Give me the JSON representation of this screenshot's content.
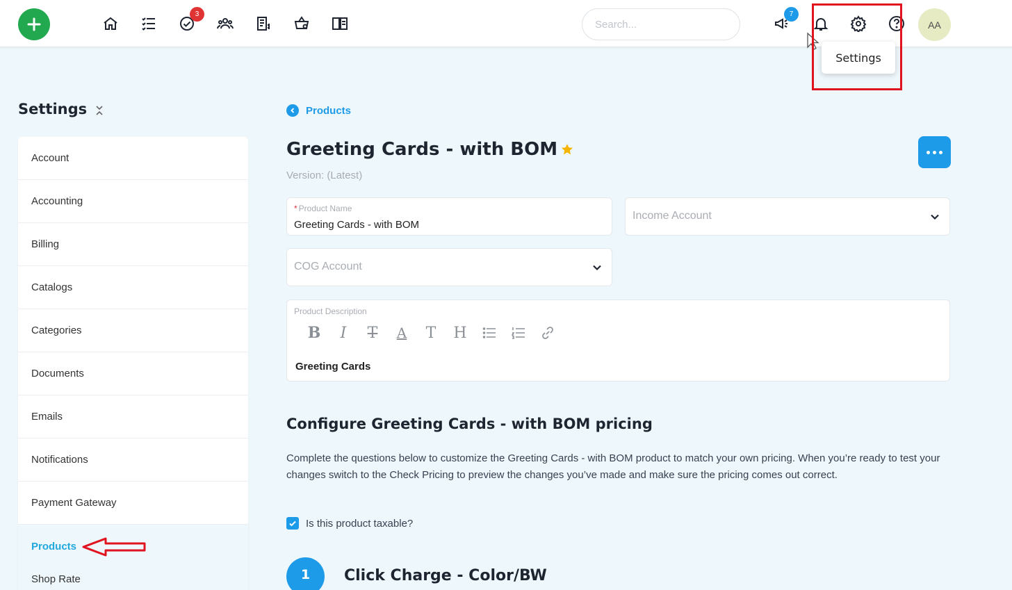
{
  "header": {
    "add_icon": "plus-icon",
    "nav_icons": [
      "home-icon",
      "list-icon",
      "tasks-check-icon",
      "users-group-icon",
      "invoice-icon",
      "shop-basket-icon",
      "catalog-book-icon"
    ],
    "tasks_badge": "3",
    "announcements_badge": "7",
    "search_placeholder": "Search...",
    "avatar_initials": "AA",
    "settings_tooltip": "Settings",
    "accent": "#1e9be8",
    "add_color": "#22a94f"
  },
  "sidebar": {
    "title": "Settings",
    "items": [
      {
        "label": "Account"
      },
      {
        "label": "Accounting"
      },
      {
        "label": "Billing"
      },
      {
        "label": "Catalogs"
      },
      {
        "label": "Categories"
      },
      {
        "label": "Documents"
      },
      {
        "label": "Emails"
      },
      {
        "label": "Notifications"
      },
      {
        "label": "Payment Gateway"
      },
      {
        "label": "Products"
      },
      {
        "label": "Shop Rate"
      }
    ],
    "active": "Products"
  },
  "main": {
    "breadcrumb": "Products",
    "title": "Greeting Cards - with BOM",
    "version": "Version: (Latest)",
    "product_name_label": "Product Name",
    "product_name_value": "Greeting Cards - with BOM",
    "income_account_placeholder": "Income Account",
    "cog_account_placeholder": "COG Account",
    "description_label": "Product Description",
    "toolbar": {
      "bold": "B",
      "italic": "I",
      "strike": "T",
      "color": "A",
      "size": "T",
      "heading": "H"
    },
    "description_value": "Greeting Cards",
    "section_title": "Configure Greeting Cards - with BOM pricing",
    "section_desc": "Complete the questions below to customize the Greeting Cards - with BOM product to match your own pricing. When you’re ready to test your changes switch to the Check Pricing to preview the changes you’ve made and make sure the pricing comes out correct.",
    "taxable_label": "Is this product taxable?",
    "taxable_checked": true,
    "step_number": "1",
    "step_title": "Click Charge - Color/BW"
  }
}
